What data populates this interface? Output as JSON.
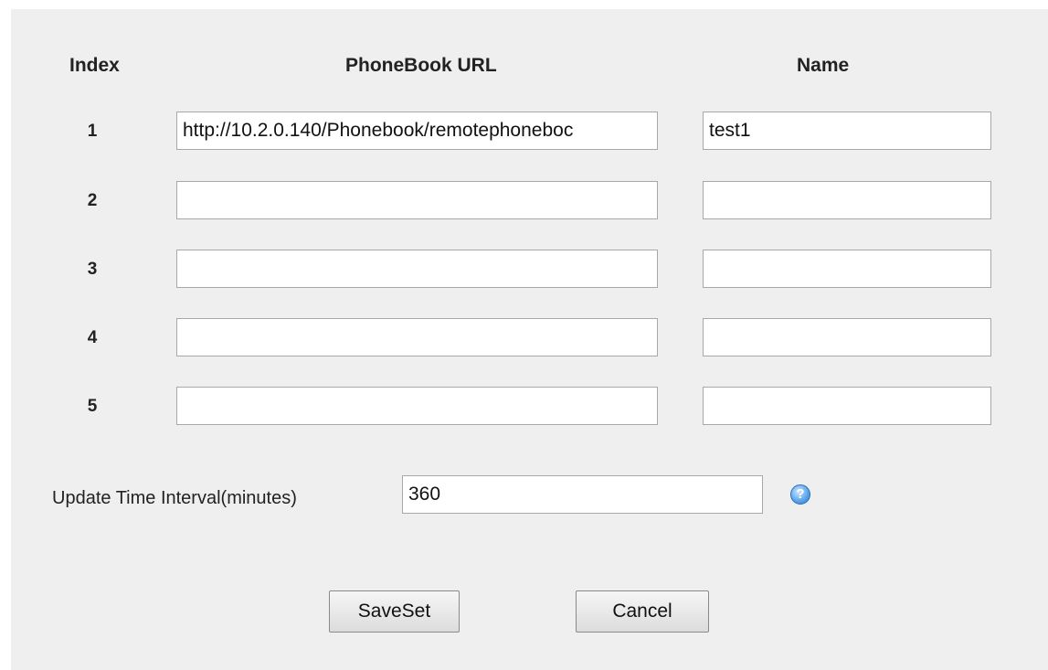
{
  "headers": {
    "index": "Index",
    "url": "PhoneBook URL",
    "name": "Name"
  },
  "rows": [
    {
      "index": "1",
      "url": "http://10.2.0.140/Phonebook/remotephoneboc",
      "name": "test1"
    },
    {
      "index": "2",
      "url": "",
      "name": ""
    },
    {
      "index": "3",
      "url": "",
      "name": ""
    },
    {
      "index": "4",
      "url": "",
      "name": ""
    },
    {
      "index": "5",
      "url": "",
      "name": ""
    }
  ],
  "update_interval": {
    "label": "Update Time Interval(minutes)",
    "value": "360",
    "help_icon": "question-icon",
    "help_glyph": "?"
  },
  "buttons": {
    "save": "SaveSet",
    "cancel": "Cancel"
  }
}
